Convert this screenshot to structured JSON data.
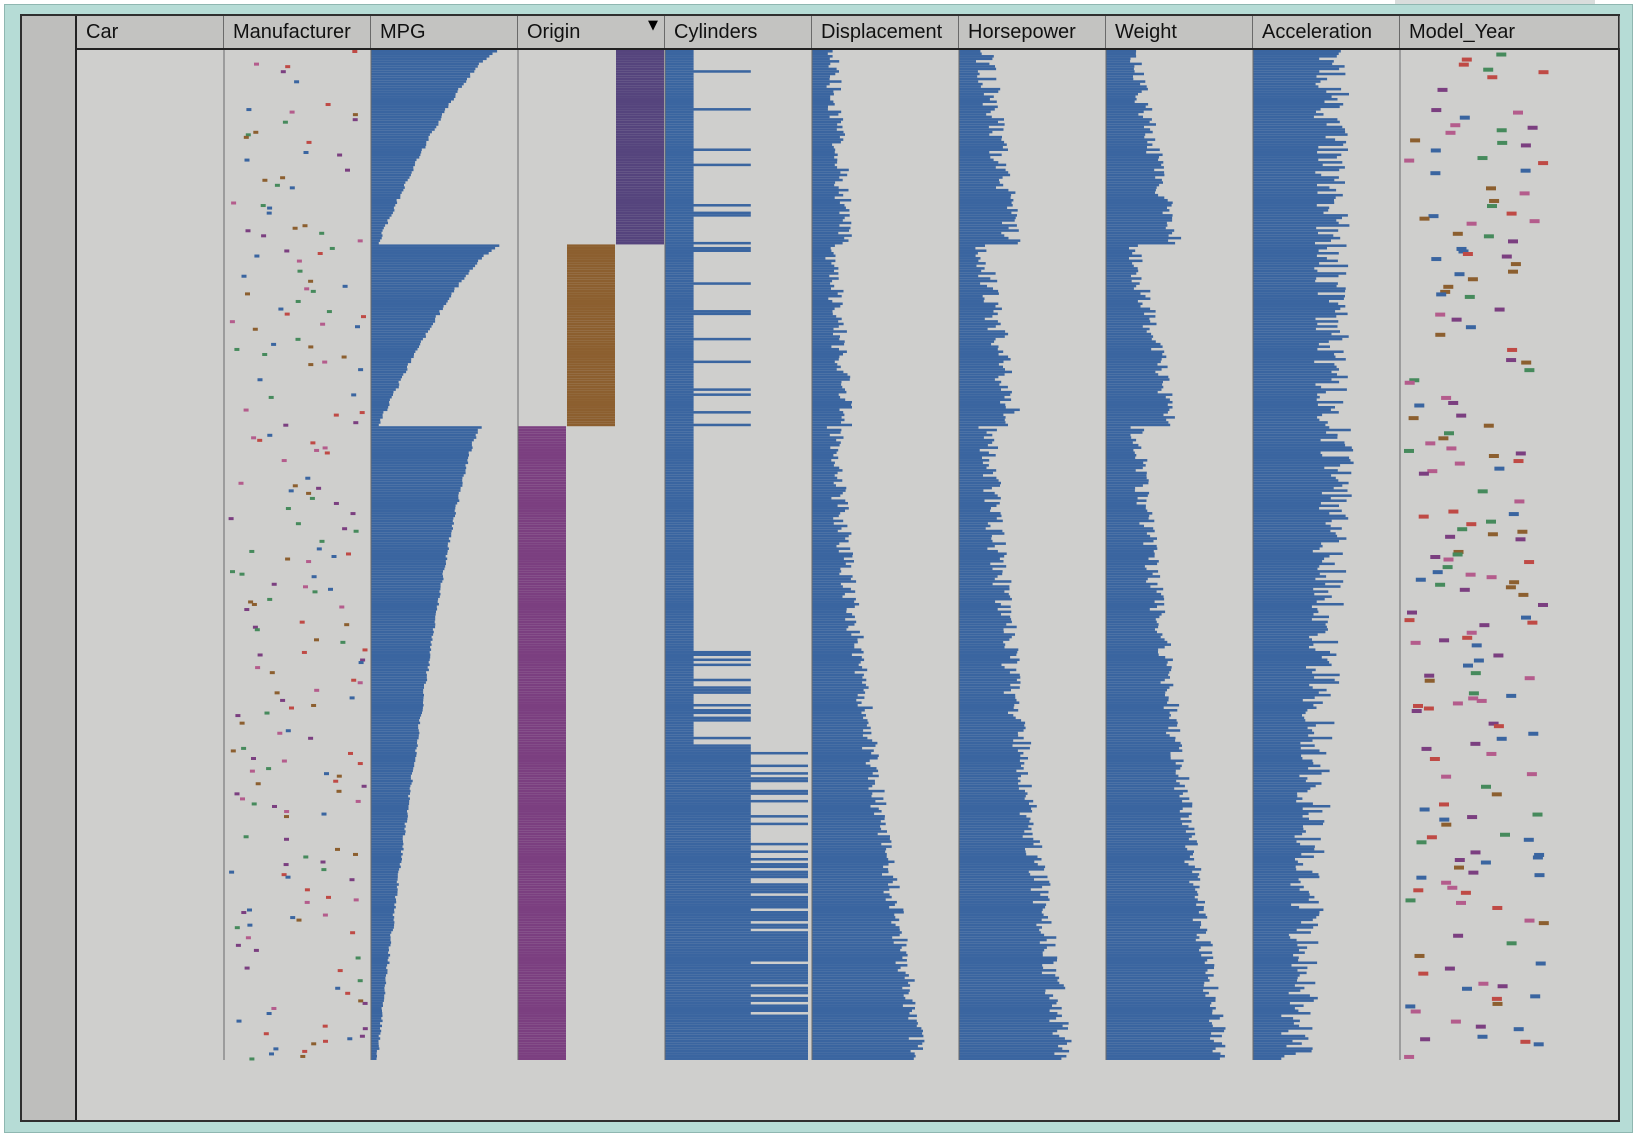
{
  "columns": [
    {
      "key": "car",
      "label": "Car"
    },
    {
      "key": "manufacturer",
      "label": "Manufacturer"
    },
    {
      "key": "mpg",
      "label": "MPG"
    },
    {
      "key": "origin",
      "label": "Origin",
      "sorted": true
    },
    {
      "key": "cylinders",
      "label": "Cylinders"
    },
    {
      "key": "displacement",
      "label": "Displacement"
    },
    {
      "key": "horsepower",
      "label": "Horsepower"
    },
    {
      "key": "weight",
      "label": "Weight"
    },
    {
      "key": "acceleration",
      "label": "Acceleration"
    },
    {
      "key": "model_year",
      "label": "Model_Year"
    }
  ],
  "sort_indicator_icon": "sort-descending-arrow-icon",
  "colors": {
    "bar": "#3a65a0",
    "background": "#cfcfcd",
    "frame": "#b6dcd6",
    "origin_1": "#55447d",
    "origin_2": "#8c5f2f",
    "origin_3": "#7b3f80",
    "category_palette": [
      "#3a65a0",
      "#bf4a45",
      "#468a5c",
      "#8c5f2f",
      "#7b3f80",
      "#b45c8c"
    ]
  },
  "chart_data": {
    "type": "table",
    "view": "table lens (one bar per row)",
    "sorted_by": "Origin",
    "groups": [
      {
        "origin": 1,
        "row_fraction": 0.193
      },
      {
        "origin": 2,
        "row_fraction": 0.18
      },
      {
        "origin": 3,
        "row_fraction": 0.627
      }
    ]
  }
}
